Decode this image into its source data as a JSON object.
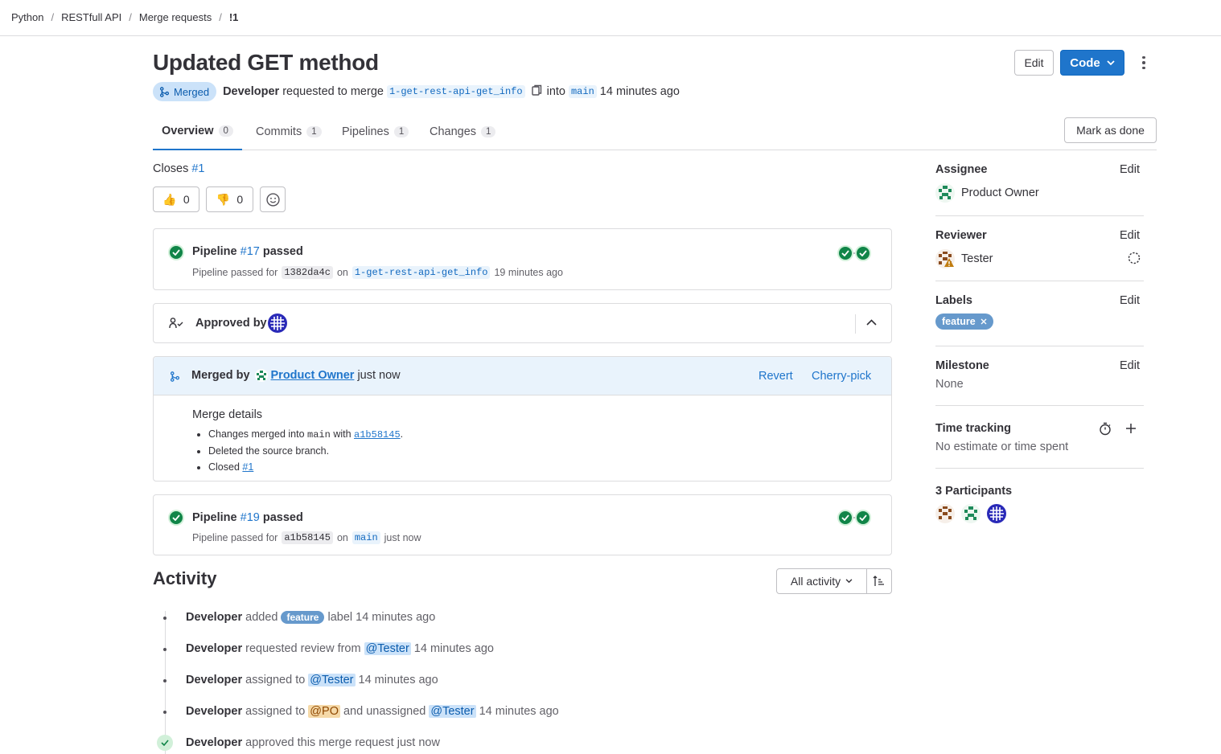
{
  "breadcrumb": [
    "Python",
    "RESTfull API",
    "Merge requests",
    "!1"
  ],
  "title": "Updated GET method",
  "header": {
    "status_badge": "Merged",
    "author": "Developer",
    "requested_text": "requested to merge",
    "source_branch": "1-get-rest-api-get_info",
    "into_text": "into",
    "target_branch": "main",
    "time": "14 minutes ago",
    "edit_label": "Edit",
    "code_label": "Code"
  },
  "tabs": [
    {
      "label": "Overview",
      "count": "0"
    },
    {
      "label": "Commits",
      "count": "1"
    },
    {
      "label": "Pipelines",
      "count": "1"
    },
    {
      "label": "Changes",
      "count": "1"
    }
  ],
  "mark_done_label": "Mark as done",
  "closes": {
    "text": "Closes",
    "issue": "#1"
  },
  "reactions": {
    "thumbs_up": "0",
    "thumbs_down": "0"
  },
  "pipeline1": {
    "prefix": "Pipeline",
    "id": "#17",
    "status": "passed",
    "sub_prefix": "Pipeline passed for",
    "sha": "1382da4c",
    "on": "on",
    "branch": "1-get-rest-api-get_info",
    "time": "19 minutes ago"
  },
  "approval": {
    "label": "Approved by"
  },
  "merged": {
    "prefix": "Merged by",
    "user": "Product Owner",
    "time": "just now",
    "revert": "Revert",
    "cherry_pick": "Cherry-pick",
    "details_title": "Merge details",
    "detail1_a": "Changes merged into",
    "detail1_branch": "main",
    "detail1_b": "with",
    "detail1_sha": "a1b58145",
    "detail1_end": ".",
    "detail2": "Deleted the source branch.",
    "detail3_a": "Closed",
    "detail3_issue": "#1"
  },
  "pipeline2": {
    "prefix": "Pipeline",
    "id": "#19",
    "status": "passed",
    "sub_prefix": "Pipeline passed for",
    "sha": "a1b58145",
    "on": "on",
    "branch": "main",
    "time": "just now"
  },
  "activity": {
    "title": "Activity",
    "filter_label": "All activity",
    "items": [
      {
        "user": "Developer",
        "a": "added",
        "label": "feature",
        "b": "label 14 minutes ago"
      },
      {
        "user": "Developer",
        "a": "requested review from",
        "mention": "@Tester",
        "b": "14 minutes ago"
      },
      {
        "user": "Developer",
        "a": "assigned to",
        "mention": "@Tester",
        "b": "14 minutes ago"
      },
      {
        "user": "Developer",
        "a": "assigned to",
        "mention": "@PO",
        "b": "and unassigned",
        "mention2": "@Tester",
        "c": "14 minutes ago"
      },
      {
        "user": "Developer",
        "a": "approved this merge request just now"
      }
    ]
  },
  "sidebar": {
    "assignee": {
      "title": "Assignee",
      "edit": "Edit",
      "value": "Product Owner"
    },
    "reviewer": {
      "title": "Reviewer",
      "edit": "Edit",
      "value": "Tester"
    },
    "labels": {
      "title": "Labels",
      "edit": "Edit",
      "value": "feature"
    },
    "milestone": {
      "title": "Milestone",
      "edit": "Edit",
      "value": "None"
    },
    "time_tracking": {
      "title": "Time tracking",
      "value": "No estimate or time spent"
    },
    "participants": {
      "title": "3 Participants"
    }
  },
  "colors": {
    "accent": "#1f75cb",
    "success": "#108548",
    "merged_bg": "#e9f3fc"
  }
}
